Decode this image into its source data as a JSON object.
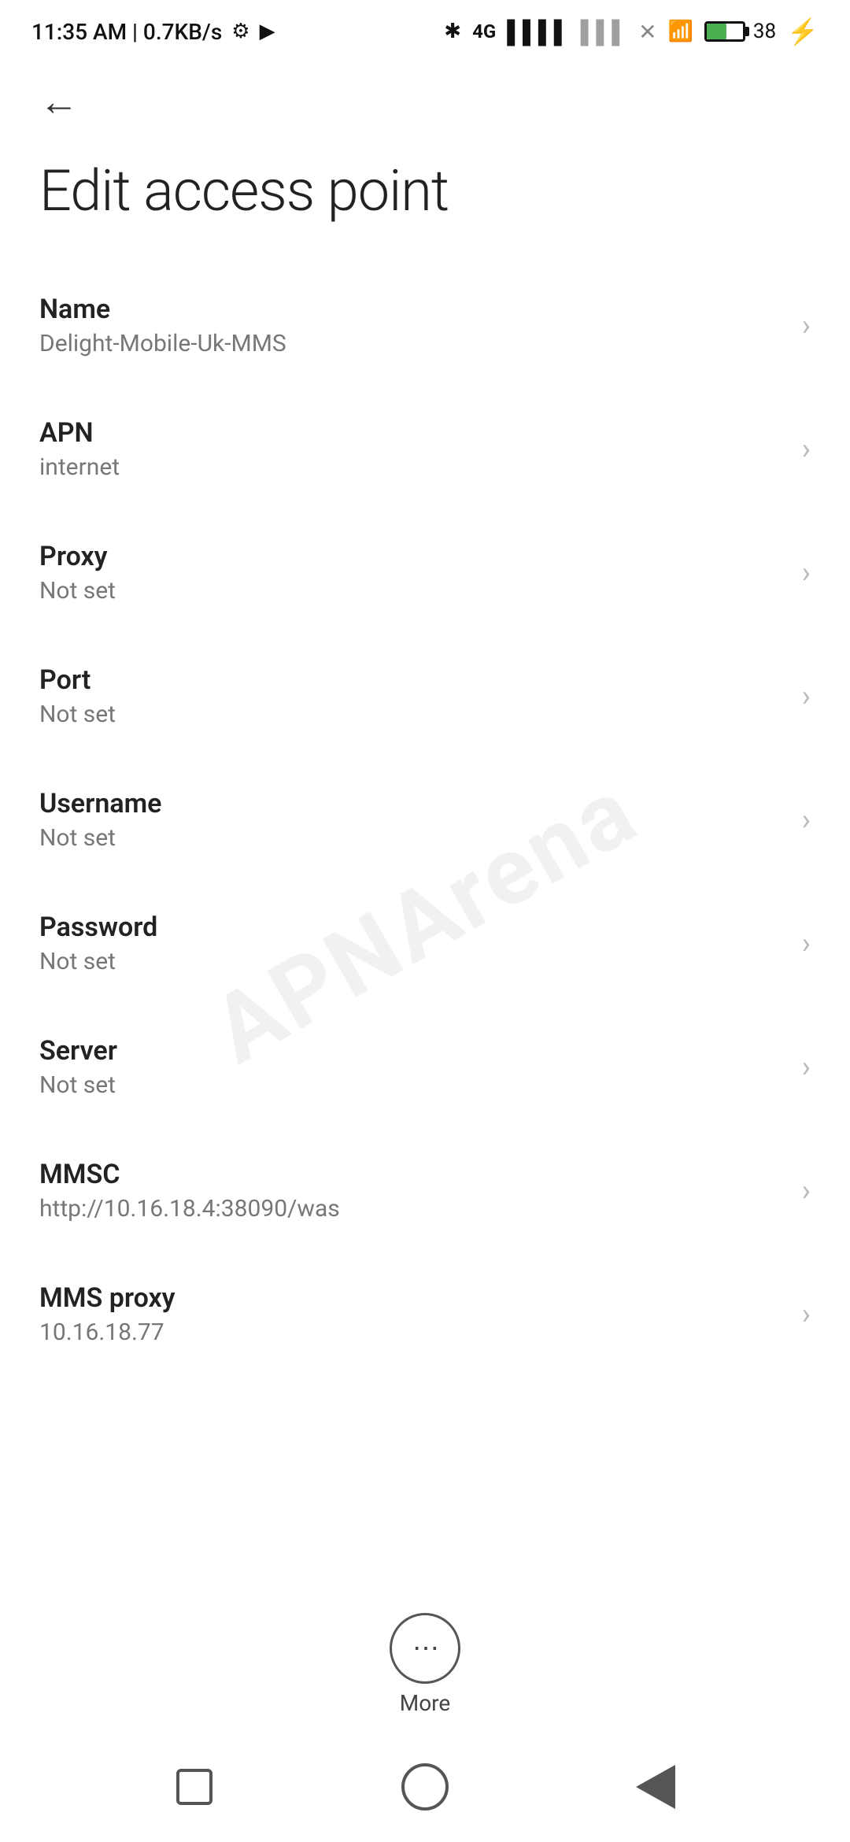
{
  "statusBar": {
    "time": "11:35 AM | 0.7KB/s",
    "batteryPercent": "38"
  },
  "page": {
    "title": "Edit access point",
    "backLabel": "Back"
  },
  "fields": [
    {
      "label": "Name",
      "value": "Delight-Mobile-Uk-MMS"
    },
    {
      "label": "APN",
      "value": "internet"
    },
    {
      "label": "Proxy",
      "value": "Not set"
    },
    {
      "label": "Port",
      "value": "Not set"
    },
    {
      "label": "Username",
      "value": "Not set"
    },
    {
      "label": "Password",
      "value": "Not set"
    },
    {
      "label": "Server",
      "value": "Not set"
    },
    {
      "label": "MMSC",
      "value": "http://10.16.18.4:38090/was"
    },
    {
      "label": "MMS proxy",
      "value": "10.16.18.77"
    }
  ],
  "more": {
    "label": "More"
  },
  "watermark": "APNArena"
}
